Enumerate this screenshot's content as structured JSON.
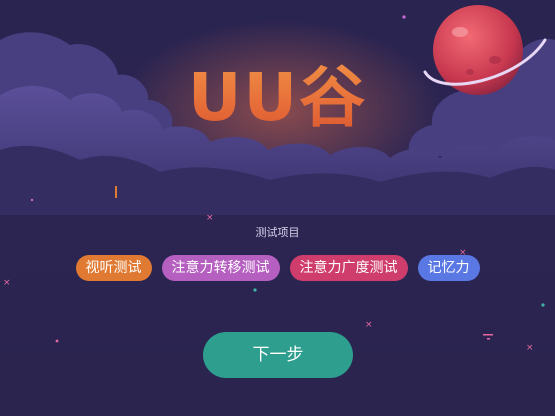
{
  "logo": {
    "text": "UU谷"
  },
  "section": {
    "title": "测试项目"
  },
  "tests": [
    {
      "label": "视听测试",
      "color": "#e07a32"
    },
    {
      "label": "注意力转移测试",
      "color": "#b55fc0"
    },
    {
      "label": "注意力广度测试",
      "color": "#cf3d6c"
    },
    {
      "label": "记忆力",
      "color": "#5a78e3"
    }
  ],
  "actions": {
    "next_label": "下一步"
  },
  "colors": {
    "background": "#2b2550",
    "cloud": "#4b4285",
    "planet": "#e0485d",
    "next_button": "#2e9e8f"
  }
}
